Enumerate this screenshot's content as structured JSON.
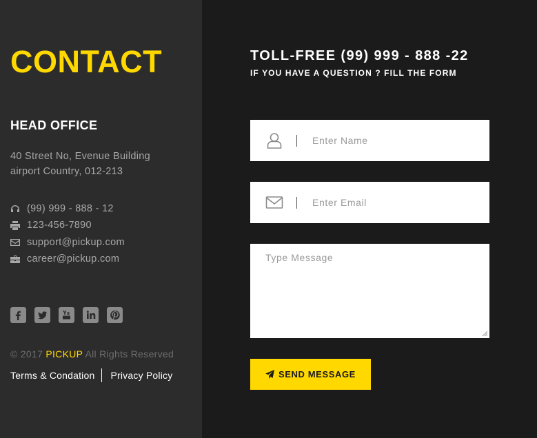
{
  "sidebar": {
    "title": "CONTACT",
    "office_heading": "HEAD OFFICE",
    "address_line1": "40 Street No, Evenue Building",
    "address_line2": "airport Country, 012-213",
    "phone": "(99) 999 - 888 - 12",
    "fax": "123-456-7890",
    "support_email": "support@pickup.com",
    "career_email": "career@pickup.com",
    "social": [
      "facebook",
      "twitter",
      "youtube",
      "linkedin",
      "pinterest"
    ],
    "copyright_prefix": "© 2017",
    "brand": "PICKUP",
    "copyright_suffix": "All Rights Reserved",
    "terms_link": "Terms & Condation",
    "privacy_link": "Privacy Policy"
  },
  "form": {
    "tollfree": "TOLL-FREE (99) 999 - 888 -22",
    "subtitle": "IF YOU HAVE A QUESTION ? FILL THE FORM",
    "name_placeholder": "Enter Name",
    "email_placeholder": "Enter Email",
    "message_placeholder": "Type Message",
    "send_label": "SEND MESSAGE"
  },
  "colors": {
    "accent": "#ffd800",
    "sidebar_bg": "#2c2c2c",
    "main_bg": "#1c1b1c"
  }
}
